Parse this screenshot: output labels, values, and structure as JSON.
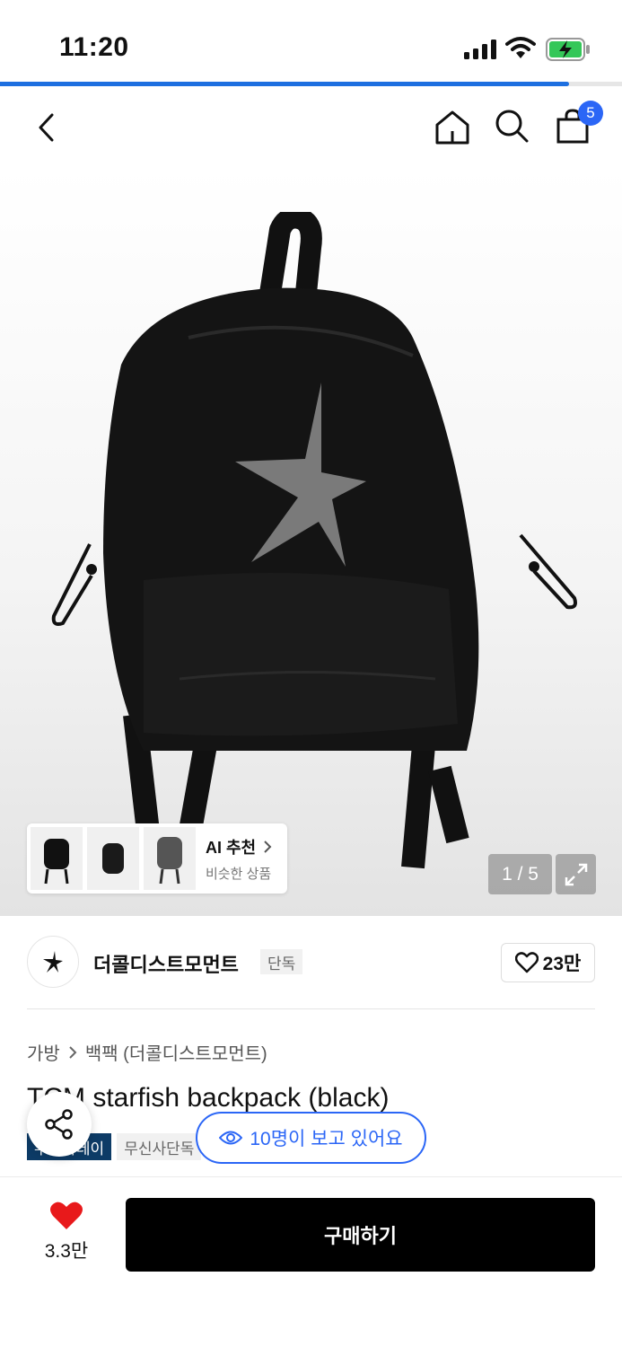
{
  "status_bar": {
    "time": "11:20",
    "page_load_progress": 0.915
  },
  "nav": {
    "cart_count": "5"
  },
  "gallery": {
    "ai_card": {
      "title": "AI 추천",
      "subtitle": "비슷한 상품"
    },
    "counter": "1 / 5"
  },
  "brand": {
    "name": "더콜디스트모먼트",
    "tag": "단독",
    "likes": "23만"
  },
  "breadcrumb": {
    "category": "가방",
    "subcategory": "백팩 (더콜디스트모먼트)"
  },
  "product": {
    "title": "TCM starfish backpack (black)"
  },
  "tags": [
    "무신사데이",
    "무신사단독"
  ],
  "viewers": "10명이 보고 있어요",
  "bottom": {
    "wish_count": "3.3만",
    "buy_label": "구매하기"
  },
  "colors": {
    "accent_blue": "#2b66f6",
    "heart_red": "#e8191b",
    "tag_navy": "#0d3b66",
    "buy_black": "#000000"
  },
  "icons": [
    "back-icon",
    "home-icon",
    "search-icon",
    "cart-icon",
    "expand-icon",
    "heart-outline-icon",
    "share-icon",
    "eye-icon",
    "heart-filled-icon",
    "chevron-right-icon"
  ]
}
